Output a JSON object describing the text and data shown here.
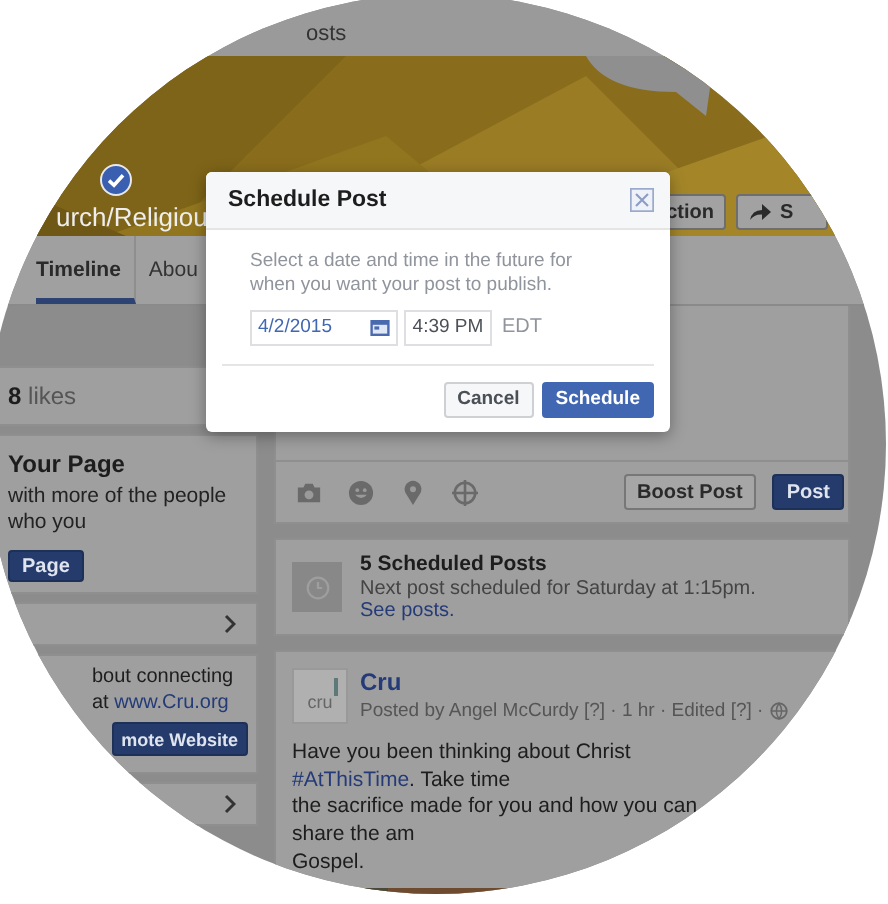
{
  "top_bar": {
    "text": "osts"
  },
  "cover": {
    "kind": "picture",
    "verified": true,
    "category": "urch/Religiou",
    "buttons": [
      {
        "label": "ction"
      },
      {
        "label": "S"
      }
    ]
  },
  "tabs": [
    {
      "label": "Timeline",
      "selected": true
    },
    {
      "label": "Abou",
      "selected": false
    }
  ],
  "likes": {
    "count": "8",
    "label": "likes"
  },
  "promote_card": {
    "title": "Your Page",
    "text": "with more of the people who you",
    "button": "Page"
  },
  "website_card": {
    "text": "bout connecting",
    "text_2": "at",
    "link": "www.Cru.org",
    "button": "mote Website"
  },
  "composer": {
    "boost_button": "Boost Post",
    "post_button": "Post"
  },
  "scheduled": {
    "title": "5 Scheduled Posts",
    "text": "Next post scheduled for Saturday at 1:15pm.",
    "link": "See posts."
  },
  "post": {
    "logo_text": "cru",
    "author": "Cru",
    "meta": "Posted by Angel McCurdy [?] · 1 hr · Edited [?] ·",
    "body_before": "Have you been thinking about Christ",
    "hashtag": "#AtThisTime",
    "body_after": [
      ". Take time",
      "the sacrifice made for you and how you can share the am",
      "Gospel."
    ]
  },
  "dialog": {
    "title": "Schedule Post",
    "message": "Select a date and time in the future for when you want your post to publish.",
    "date": "4/2/2015",
    "time": "4:39 PM",
    "timezone": "EDT",
    "buttons": [
      {
        "label": "Cancel",
        "kind": "secondary"
      },
      {
        "label": "Schedule",
        "kind": "primary"
      }
    ]
  }
}
